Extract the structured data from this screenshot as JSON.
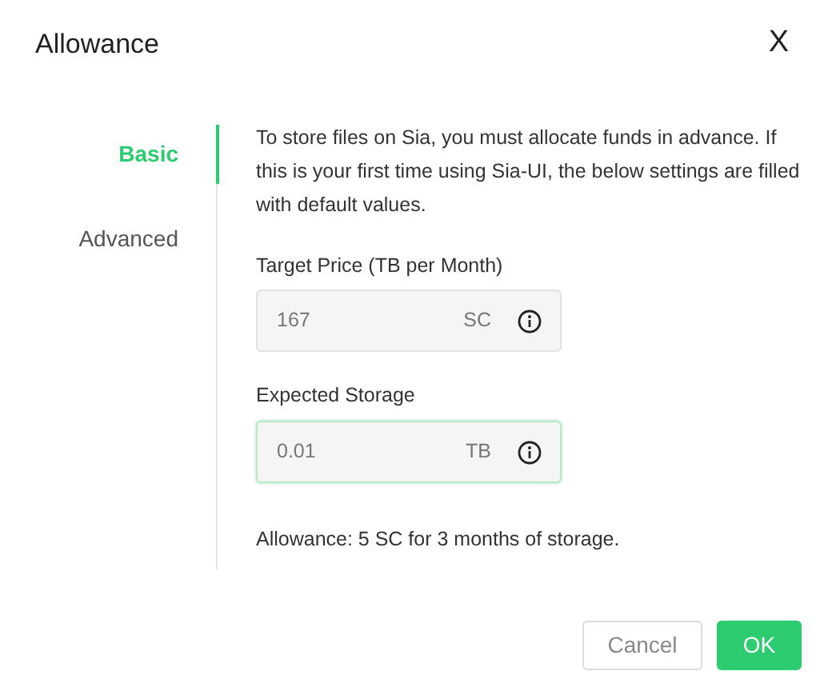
{
  "dialog": {
    "title": "Allowance",
    "close": "X"
  },
  "tabs": [
    {
      "label": "Basic",
      "selected": true
    },
    {
      "label": "Advanced",
      "selected": false
    }
  ],
  "intro": "To store files on Sia, you must allocate funds in advance. If this is your first time using Sia-UI, the below settings are filled with default values.",
  "fields": [
    {
      "label": "Target Price (TB per Month)",
      "value": "167",
      "unit": "SC",
      "focused": false
    },
    {
      "label": "Expected Storage",
      "value": "0.01",
      "unit": "TB",
      "focused": true
    }
  ],
  "summary": "Allowance: 5 SC for 3 months of storage.",
  "buttons": [
    {
      "label": "Cancel",
      "kind": "secondary"
    },
    {
      "label": "OK",
      "kind": "primary"
    }
  ]
}
